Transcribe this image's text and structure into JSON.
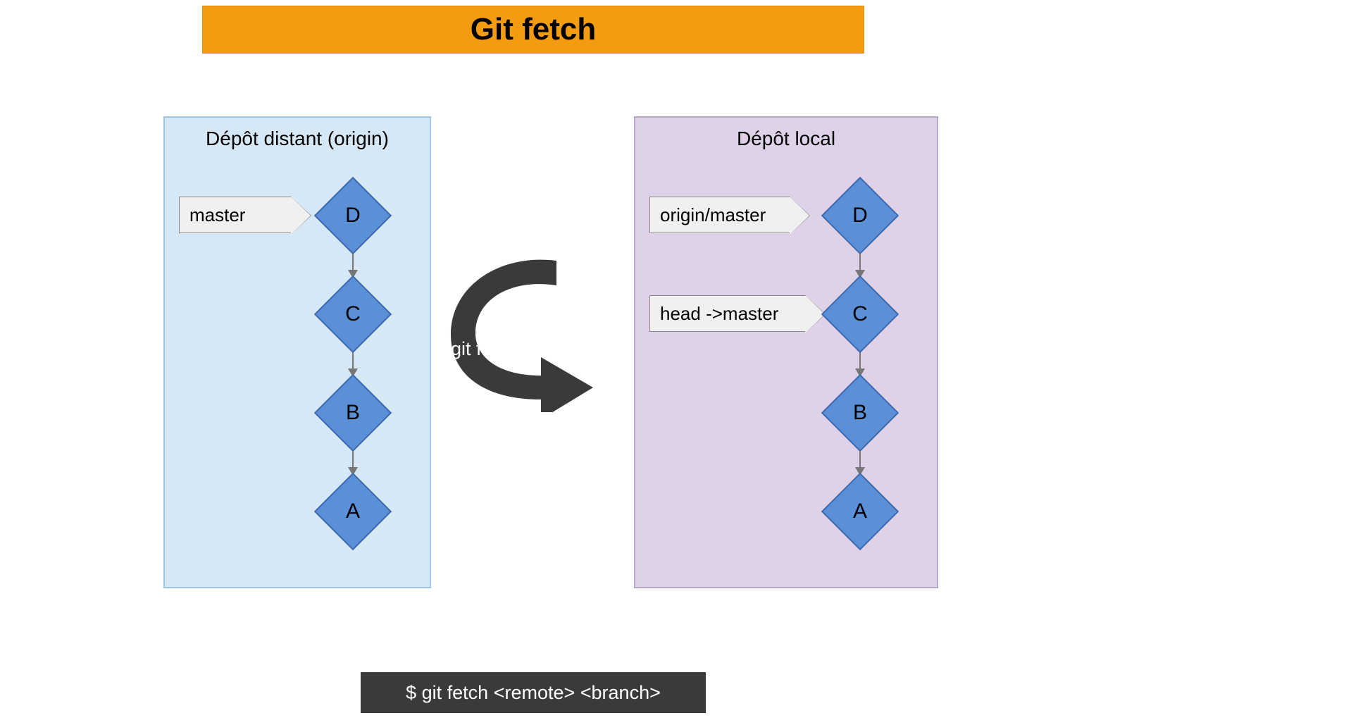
{
  "title": "Git fetch",
  "remote_panel": {
    "title": "Dépôt distant (origin)",
    "tag_master": "master",
    "commits": {
      "d": "D",
      "c": "C",
      "b": "B",
      "a": "A"
    }
  },
  "local_panel": {
    "title": "Dépôt local",
    "tag_origin_master": "origin/master",
    "tag_head_master": "head ->master",
    "commits": {
      "d": "D",
      "c": "C",
      "b": "B",
      "a": "A"
    }
  },
  "fetch_arrow_label": "git fetch",
  "command": "$ git fetch <remote> <branch>"
}
